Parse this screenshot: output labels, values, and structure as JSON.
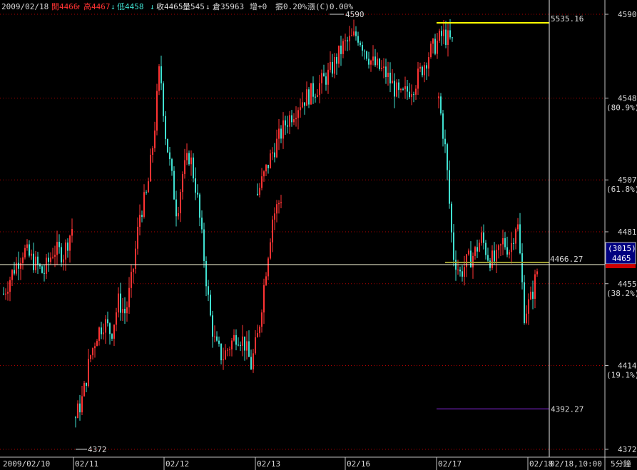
{
  "header": {
    "date": "2009/02/18",
    "open": "開4466",
    "open_arrow": "↑",
    "high": "高4467",
    "high_arrow": "↓",
    "low": "低4458",
    "low_arrow": "↓",
    "close": "收4465",
    "volume": "量545",
    "vol_arrow": "↓",
    "oi": "倉35963",
    "oi_change": "增+0",
    "amplitude": "振0.20%",
    "change": "漲(C)0.00%"
  },
  "chart_data": {
    "type": "candlestick",
    "interval_label": "5分鐘",
    "ylim": [
      4372,
      4590
    ],
    "y_ticks": [
      {
        "value": 4590,
        "label": "4590"
      },
      {
        "value": 4548,
        "label": "4548",
        "sub": "(80.9%)"
      },
      {
        "value": 4507,
        "label": "4507",
        "sub": "(61.8%)"
      },
      {
        "value": 4481,
        "label": "4481"
      },
      {
        "value": 4455,
        "label": "4455",
        "sub": "(38.2%)"
      },
      {
        "value": 4414,
        "label": "4414",
        "sub": "(19.1%)"
      },
      {
        "value": 4372,
        "label": "4372"
      }
    ],
    "x_labels": [
      "2009/02/10",
      "02/11",
      "02/12",
      "02/13",
      "02/16",
      "02/17",
      "02/18"
    ],
    "cursor_time": "02/18,10:00",
    "current_price_box": {
      "oi": "(3015)",
      "price": "4465"
    },
    "annotations": {
      "high_label": "4590",
      "low_label": "4372",
      "crosshair_price": "4466.27",
      "yellow_line_label": "5535.16",
      "purple_line_label": "4392.27"
    },
    "series": [
      {
        "segment": "02/10",
        "points": [
          [
            0,
            4450
          ],
          [
            14,
            4462
          ],
          [
            28,
            4472
          ],
          [
            42,
            4466
          ],
          [
            56,
            4460
          ],
          [
            70,
            4472
          ],
          [
            84,
            4470
          ],
          [
            98,
            4485
          ]
        ]
      },
      {
        "segment": "02/11",
        "points": [
          [
            0,
            4388
          ],
          [
            10,
            4398
          ],
          [
            20,
            4418
          ],
          [
            30,
            4430
          ],
          [
            40,
            4436
          ],
          [
            50,
            4430
          ],
          [
            60,
            4446
          ],
          [
            70,
            4440
          ],
          [
            80,
            4460
          ],
          [
            90,
            4490
          ],
          [
            100,
            4500
          ],
          [
            110,
            4530
          ],
          [
            118,
            4565
          ],
          [
            126,
            4530
          ],
          [
            134,
            4510
          ],
          [
            142,
            4490
          ],
          [
            150,
            4510
          ],
          [
            160,
            4520
          ],
          [
            170,
            4500
          ],
          [
            180,
            4468
          ],
          [
            188,
            4440
          ],
          [
            196,
            4424
          ],
          [
            206,
            4418
          ],
          [
            216,
            4424
          ],
          [
            226,
            4430
          ],
          [
            236,
            4426
          ],
          [
            246,
            4414
          ],
          [
            256,
            4430
          ],
          [
            266,
            4460
          ],
          [
            276,
            4488
          ],
          [
            290,
            4500
          ]
        ]
      },
      {
        "segment": "02/13",
        "points": [
          [
            0,
            4500
          ],
          [
            20,
            4520
          ],
          [
            40,
            4536
          ],
          [
            60,
            4546
          ],
          [
            80,
            4552
          ],
          [
            100,
            4560
          ],
          [
            120,
            4574
          ],
          [
            140,
            4580
          ],
          [
            160,
            4566
          ],
          [
            180,
            4560
          ],
          [
            200,
            4548
          ],
          [
            220,
            4555
          ],
          [
            240,
            4570
          ],
          [
            260,
            4580
          ],
          [
            275,
            4575
          ]
        ]
      },
      {
        "segment": "02/17",
        "points": [
          [
            0,
            4548
          ],
          [
            10,
            4520
          ],
          [
            20,
            4470
          ],
          [
            30,
            4460
          ],
          [
            40,
            4466
          ],
          [
            50,
            4470
          ],
          [
            60,
            4478
          ],
          [
            70,
            4468
          ],
          [
            80,
            4466
          ],
          [
            90,
            4476
          ],
          [
            100,
            4472
          ],
          [
            110,
            4488
          ],
          [
            120,
            4440
          ],
          [
            130,
            4448
          ],
          [
            140,
            4465
          ]
        ]
      }
    ]
  },
  "colors": {
    "background": "#000000",
    "up": "#ff3333",
    "down": "#40e0d0",
    "grid": "#b00000",
    "axis_text": "#d8d8d8",
    "yellow": "#ffff00",
    "purple": "#8a2be2",
    "crosshair": "#ffffe0"
  }
}
